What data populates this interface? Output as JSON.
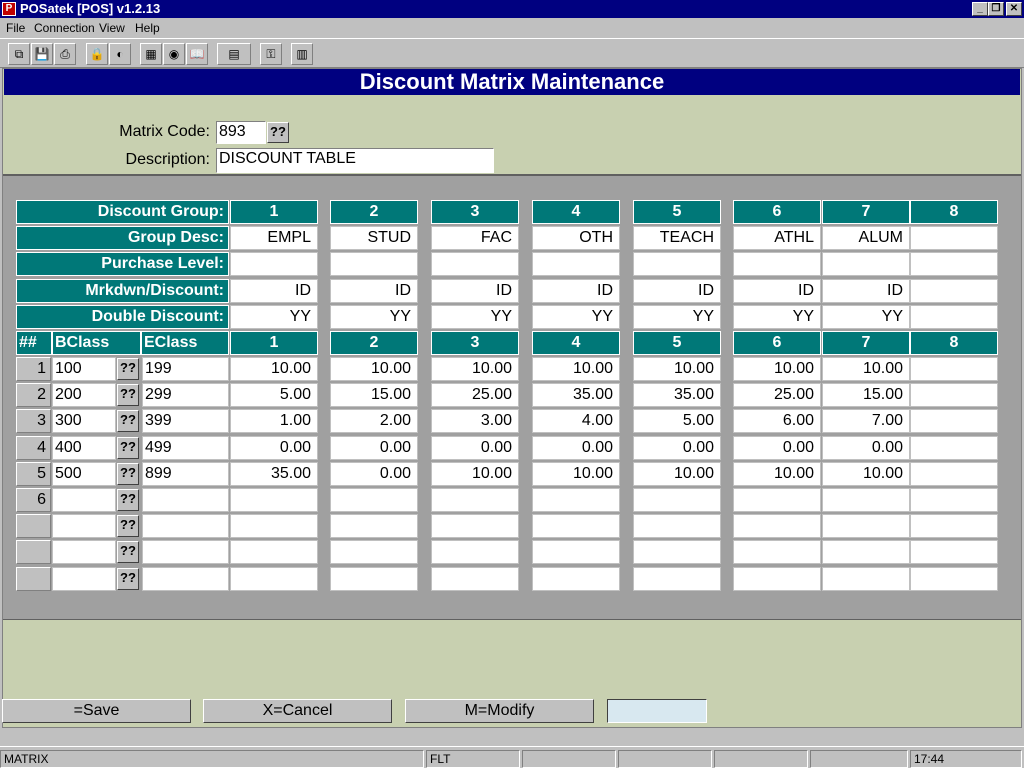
{
  "window": {
    "title": "POSatek [POS]  v1.2.13",
    "app_icon": "P",
    "minimize": "_",
    "restore": "❐",
    "close": "✕"
  },
  "menu": [
    "File",
    "Connection",
    "View",
    "Help"
  ],
  "toolbar": {
    "icons": [
      "copy-icon",
      "save-icon",
      "print-icon",
      "lock-icon",
      "audio-icon",
      "calculator-icon",
      "monitor-icon",
      "book-icon",
      "document-dropdown-icon",
      "network-icon",
      "chart-icon"
    ],
    "glyphs": [
      "⧉",
      "💾",
      "⎙",
      "🔒",
      "◐",
      "▦",
      "◉",
      "📖",
      "▤",
      "⚿",
      "▥"
    ]
  },
  "page": {
    "title": "Discount Matrix Maintenance"
  },
  "form": {
    "matrix_code_label": "Matrix Code:",
    "matrix_code_value": "893",
    "lookup_label": "??",
    "description_label": "Description:",
    "description_value": "DISCOUNT TABLE"
  },
  "grid": {
    "row_labels": {
      "discount_group": "Discount Group:",
      "group_desc": "Group Desc:",
      "purchase_level": "Purchase Level:",
      "mrkdwn": "Mrkdwn/Discount:",
      "double_discount": "Double Discount:"
    },
    "groups": [
      "1",
      "2",
      "3",
      "4",
      "5",
      "6",
      "7",
      "8"
    ],
    "group_desc": [
      "EMPL",
      "STUD",
      "FAC",
      "OTH",
      "TEACH",
      "ATHL",
      "ALUM",
      ""
    ],
    "purchase_level": [
      "",
      "",
      "",
      "",
      "",
      "",
      "",
      ""
    ],
    "mrkdwn": [
      "ID",
      "ID",
      "ID",
      "ID",
      "ID",
      "ID",
      "ID",
      ""
    ],
    "double_discount": [
      "YY",
      "YY",
      "YY",
      "YY",
      "YY",
      "YY",
      "YY",
      ""
    ],
    "col_headers": {
      "num": "##",
      "bclass": "BClass",
      "eclass": "EClass"
    },
    "rows": [
      {
        "n": "1",
        "bclass": "100",
        "eclass": "199",
        "values": [
          "10.00",
          "10.00",
          "10.00",
          "10.00",
          "10.00",
          "10.00",
          "10.00",
          ""
        ]
      },
      {
        "n": "2",
        "bclass": "200",
        "eclass": "299",
        "values": [
          "5.00",
          "15.00",
          "25.00",
          "35.00",
          "35.00",
          "25.00",
          "15.00",
          ""
        ]
      },
      {
        "n": "3",
        "bclass": "300",
        "eclass": "399",
        "values": [
          "1.00",
          "2.00",
          "3.00",
          "4.00",
          "5.00",
          "6.00",
          "7.00",
          ""
        ]
      },
      {
        "n": "4",
        "bclass": "400",
        "eclass": "499",
        "values": [
          "0.00",
          "0.00",
          "0.00",
          "0.00",
          "0.00",
          "0.00",
          "0.00",
          ""
        ]
      },
      {
        "n": "5",
        "bclass": "500",
        "eclass": "899",
        "values": [
          "35.00",
          "0.00",
          "10.00",
          "10.00",
          "10.00",
          "10.00",
          "10.00",
          ""
        ]
      },
      {
        "n": "6",
        "bclass": "",
        "eclass": "",
        "values": [
          "",
          "",
          "",
          "",
          "",
          "",
          "",
          ""
        ]
      },
      {
        "n": "",
        "bclass": "",
        "eclass": "",
        "values": [
          "",
          "",
          "",
          "",
          "",
          "",
          "",
          ""
        ]
      },
      {
        "n": "",
        "bclass": "",
        "eclass": "",
        "values": [
          "",
          "",
          "",
          "",
          "",
          "",
          "",
          ""
        ]
      },
      {
        "n": "",
        "bclass": "",
        "eclass": "",
        "values": [
          "",
          "",
          "",
          "",
          "",
          "",
          "",
          ""
        ]
      }
    ]
  },
  "buttons": {
    "save": "=Save",
    "cancel": "X=Cancel",
    "modify": "M=Modify",
    "blank": ""
  },
  "status": {
    "screen": "MATRIX",
    "mode": "FLT",
    "time": "17:44"
  }
}
